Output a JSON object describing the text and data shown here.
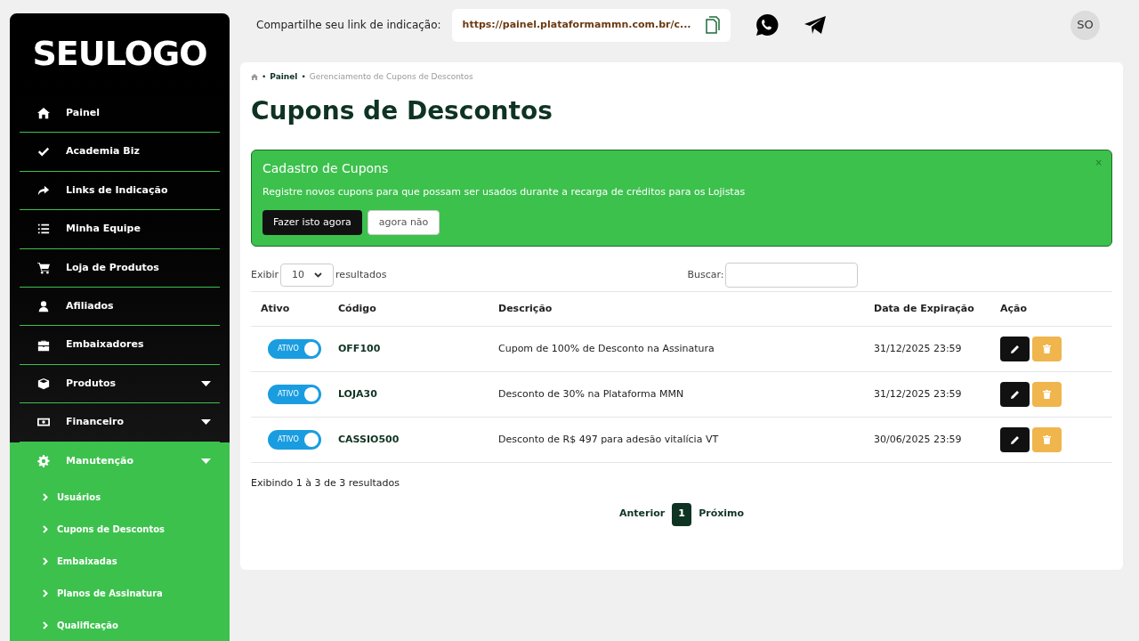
{
  "sidebar": {
    "logo": "SEULOGO",
    "items": [
      {
        "label": "Painel",
        "expandable": false,
        "expanded": false
      },
      {
        "label": "Academia Biz",
        "expandable": false,
        "expanded": false
      },
      {
        "label": "Links de Indicação",
        "expandable": false,
        "expanded": false
      },
      {
        "label": "Minha Equipe",
        "expandable": false,
        "expanded": false
      },
      {
        "label": "Loja de Produtos",
        "expandable": false,
        "expanded": false
      },
      {
        "label": "Afiliados",
        "expandable": false,
        "expanded": false
      },
      {
        "label": "Embaixadores",
        "expandable": false,
        "expanded": false
      },
      {
        "label": "Produtos",
        "expandable": true,
        "expanded": false
      },
      {
        "label": "Financeiro",
        "expandable": true,
        "expanded": false
      },
      {
        "label": "Manutenção",
        "expandable": true,
        "expanded": true,
        "children": [
          {
            "label": "Usuários"
          },
          {
            "label": "Cupons de Descontos"
          },
          {
            "label": "Embaixadas"
          },
          {
            "label": "Planos de Assinatura"
          },
          {
            "label": "Qualificação"
          }
        ]
      }
    ]
  },
  "topbar": {
    "share_label": "Compartilhe seu link de indicação:",
    "link": "https://painel.plataformammn.com.br/c...",
    "avatar": "SO"
  },
  "breadcrumb": {
    "separator": "•",
    "items": [
      "Painel",
      "Gerenciamento de Cupons de Descontos"
    ]
  },
  "title": "Cupons de Descontos",
  "alert": {
    "title": "Cadastro de Cupons",
    "text": "Registre novos cupons para que possam ser usados durante a recarga de créditos para os Lojistas",
    "close": "×",
    "primary": "Fazer isto agora",
    "secondary": "agora não"
  },
  "table_controls": {
    "show_label": "Exibir",
    "page_size": "10",
    "results_label": "resultados",
    "search_label": "Buscar:"
  },
  "table": {
    "columns": [
      "Ativo",
      "Código",
      "Descrição",
      "Data de Expiração",
      "Ação"
    ],
    "rows": [
      {
        "active": {
          "on": true,
          "label": "ATIVO"
        },
        "code": "OFF100",
        "description": "Cupom de 100% de Desconto na Assinatura",
        "expires": "31/12/2025 23:59"
      },
      {
        "active": {
          "on": true,
          "label": "ATIVO"
        },
        "code": "LOJA30",
        "description": "Desconto de 30% na Plataforma MMN",
        "expires": "31/12/2025 23:59"
      },
      {
        "active": {
          "on": true,
          "label": "ATIVO"
        },
        "code": "CASSIO500",
        "description": "Desconto de R$ 497 para adesão vitalícia VT",
        "expires": "30/06/2025 23:59"
      }
    ]
  },
  "info": "Exibindo 1 à 3 de 3 resultados",
  "pagination": {
    "previous": "Anterior",
    "pages": [
      {
        "label": "1",
        "selected": true
      }
    ],
    "next": "Próximo"
  }
}
